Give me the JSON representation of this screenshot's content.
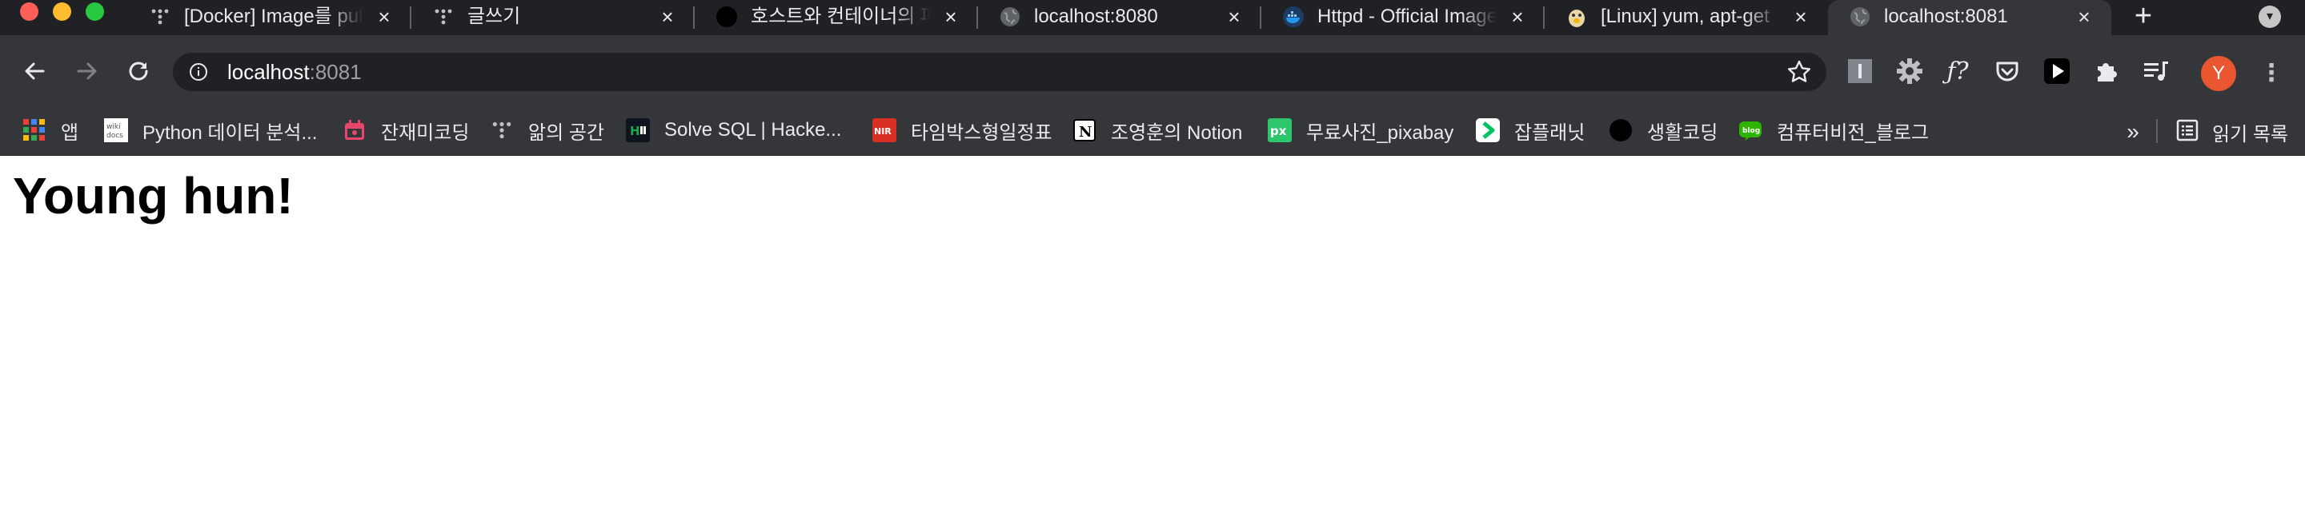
{
  "browser": {
    "tabs": [
      {
        "title": "[Docker] Image를 pull",
        "favicon": "dots-icon"
      },
      {
        "title": "글쓰기",
        "favicon": "dots-icon"
      },
      {
        "title": "호스트와 컨테이너의 파일",
        "favicon": "black-circle-icon"
      },
      {
        "title": "localhost:8080",
        "favicon": "globe-icon"
      },
      {
        "title": "Httpd - Official Image",
        "favicon": "docker-icon"
      },
      {
        "title": "[Linux] yum, apt-get",
        "favicon": "python-icon"
      },
      {
        "title": "localhost:8081",
        "favicon": "globe-icon",
        "active": true
      }
    ],
    "new_tab_label": "+",
    "address_bar": {
      "host": "localhost",
      "port": ":8081"
    },
    "profile_initial": "Y",
    "bookmarks": [
      {
        "label": "앱",
        "icon": "apps-grid-icon"
      },
      {
        "label": "Python 데이터 분석...",
        "icon": "wikidocs-icon"
      },
      {
        "label": "잔재미코딩",
        "icon": "calendar-icon"
      },
      {
        "label": "앎의 공간",
        "icon": "dots-icon"
      },
      {
        "label": "Solve SQL | Hacke...",
        "icon": "hackerrank-icon"
      },
      {
        "label": "타임박스형일정표",
        "icon": "nir-icon"
      },
      {
        "label": "조영훈의 Notion",
        "icon": "notion-icon"
      },
      {
        "label": "무료사진_pixabay",
        "icon": "pixabay-icon"
      },
      {
        "label": "잡플래닛",
        "icon": "jobplanet-icon"
      },
      {
        "label": "생활코딩",
        "icon": "black-circle-icon"
      },
      {
        "label": "컴퓨터비전_블로그",
        "icon": "blog-icon"
      }
    ],
    "bookmarks_overflow": "»",
    "reading_list_label": "읽기 목록",
    "colors": {
      "frame": "#202124",
      "toolbar": "#35363a",
      "avatar": "#e8572f"
    }
  },
  "page": {
    "heading": "Young hun!"
  }
}
